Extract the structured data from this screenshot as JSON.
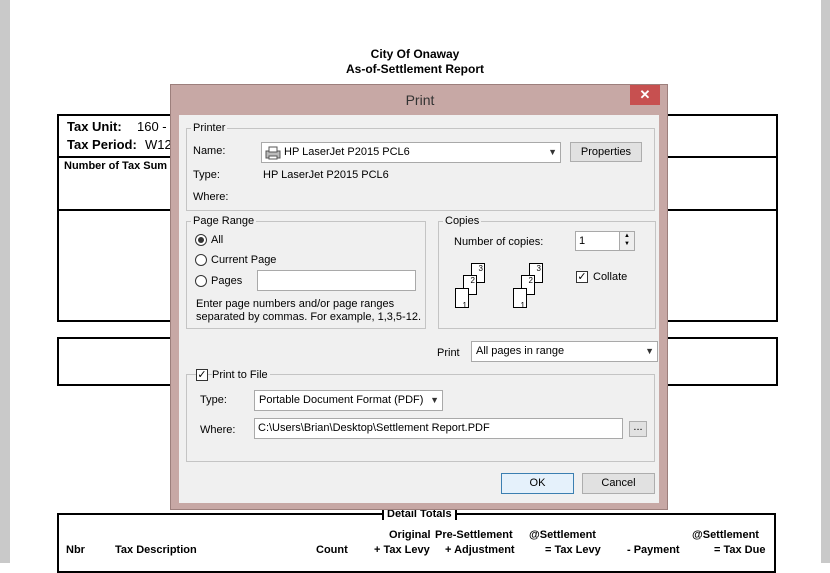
{
  "report": {
    "org": "City Of Onaway",
    "title": "As-of-Settlement Report",
    "tax_unit_label": "Tax Unit:",
    "tax_unit_value": "160 -",
    "tax_period_label": "Tax Period:",
    "tax_period_value": "W12",
    "summary_label": "Number of Tax Sum",
    "detail_totals_label": "Detail Totals",
    "columns": [
      {
        "line1": "",
        "line2": "Nbr"
      },
      {
        "line1": "",
        "line2": "Tax Description"
      },
      {
        "line1": "",
        "line2": "Count"
      },
      {
        "line1": "Original",
        "line2": "+ Tax Levy"
      },
      {
        "line1": "Pre-Settlement",
        "line2": "+ Adjustment"
      },
      {
        "line1": "@Settlement",
        "line2": "= Tax Levy"
      },
      {
        "line1": "",
        "line2": "- Payment"
      },
      {
        "line1": "@Settlement",
        "line2": "= Tax Due"
      }
    ]
  },
  "dialog": {
    "title": "Print",
    "close_glyph": "✕",
    "printer": {
      "group_label": "Printer",
      "name_label": "Name:",
      "name_value": "HP LaserJet P2015 PCL6",
      "properties_button": "Properties",
      "type_label": "Type:",
      "type_value": "HP LaserJet P2015 PCL6",
      "where_label": "Where:",
      "where_value": ""
    },
    "page_range": {
      "group_label": "Page Range",
      "options": [
        "All",
        "Current Page",
        "Pages"
      ],
      "selected": "All",
      "pages_value": "",
      "hint_line1": "Enter page numbers and/or page ranges",
      "hint_line2": "separated by commas.  For example, 1,3,5-12."
    },
    "copies": {
      "group_label": "Copies",
      "number_label": "Number of copies:",
      "number_value": "1",
      "collate_label": "Collate",
      "collate_checked": true,
      "sheet_numbers": [
        "1",
        "2",
        "3"
      ]
    },
    "print_label": "Print",
    "print_value": "All pages in range",
    "print_to_file": {
      "label": "Print to File",
      "checked": true,
      "type_label": "Type:",
      "type_value": "Portable Document Format (PDF)",
      "where_label": "Where:",
      "where_value": "C:\\Users\\Brian\\Desktop\\Settlement Report.PDF",
      "browse_label": "..."
    },
    "ok_button": "OK",
    "cancel_button": "Cancel"
  },
  "colors": {
    "dialog_frame": "#c7a8a5",
    "close_button": "#c75050",
    "client_bg": "#f0f0f0"
  }
}
